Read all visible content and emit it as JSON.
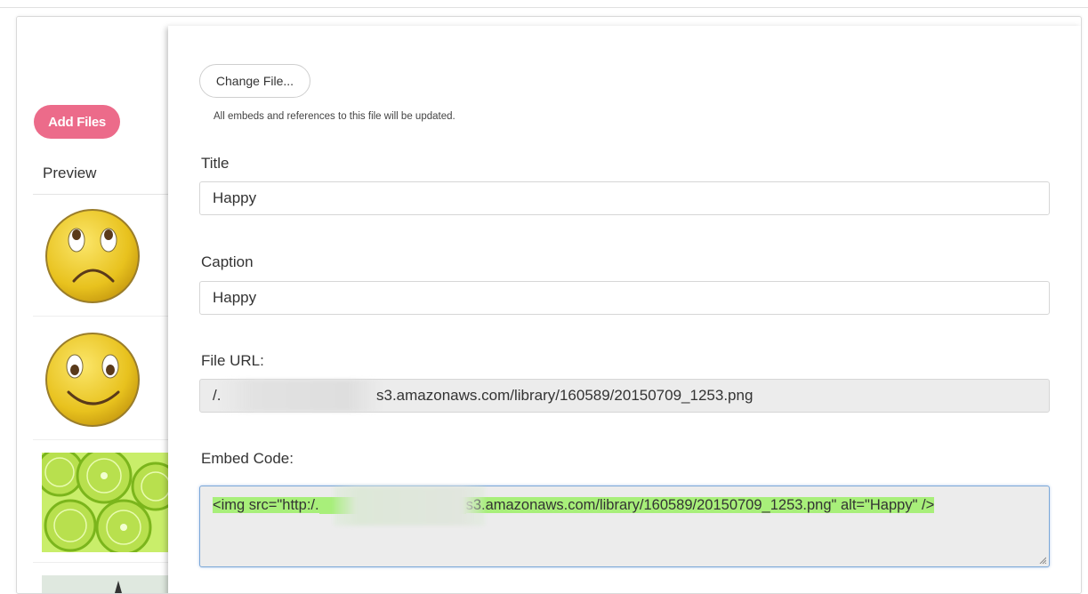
{
  "sidebar": {
    "add_files_label": "Add Files",
    "preview_header": "Preview",
    "thumbnails": [
      "sad-face-thumbnail",
      "happy-face-thumbnail",
      "lime-slices-thumbnail",
      "partial-thumbnail"
    ]
  },
  "editor": {
    "change_file_label": "Change File...",
    "hint": "All embeds and references to this file will be updated.",
    "title_label": "Title",
    "title_value": "Happy",
    "caption_label": "Caption",
    "caption_value": "Happy",
    "file_url_label": "File URL:",
    "file_url_prefix": "/.",
    "file_url_suffix": "s3.amazonaws.com/library/160589/20150709_1253.png",
    "embed_label": "Embed Code:",
    "embed_prefix": "<img src=\"http:/.",
    "embed_suffix": "s3.amazonaws.com/library/160589/20150709_1253.png\" alt=\"Happy\" />"
  },
  "colors": {
    "accent": "#ec6b8a",
    "highlight": "#a8ef7a",
    "focus_border": "#7aa7d8"
  }
}
